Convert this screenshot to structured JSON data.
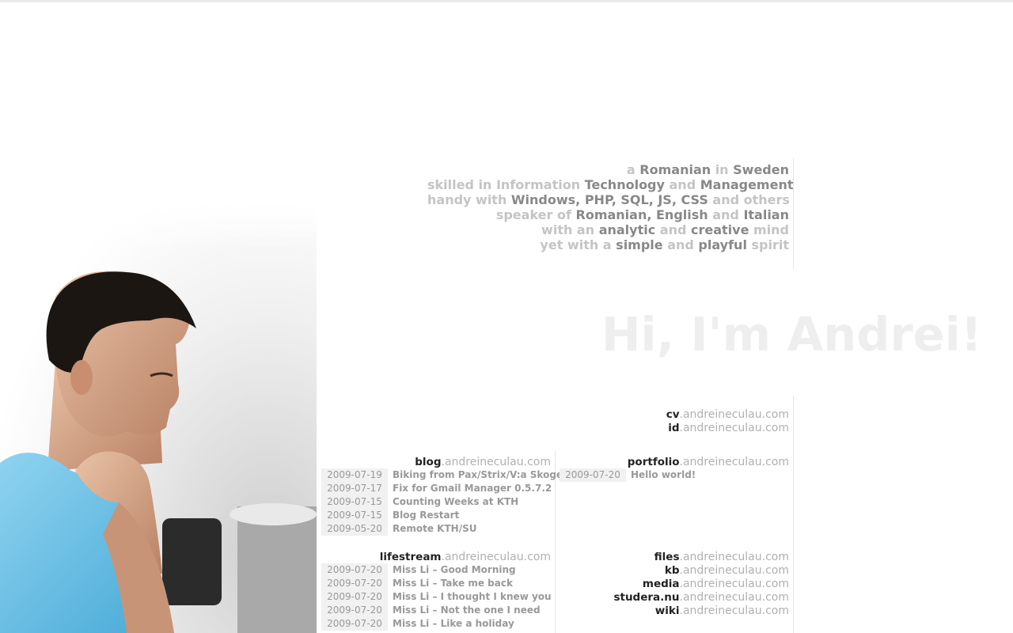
{
  "tagline": [
    [
      {
        "t": "a ",
        "h": false
      },
      {
        "t": "Romanian",
        "h": true
      },
      {
        "t": " in ",
        "h": false
      },
      {
        "t": "Sweden",
        "h": true
      }
    ],
    [
      {
        "t": "skilled in ",
        "h": false
      },
      {
        "t": "Information",
        "h": false
      },
      {
        "t": " Technology",
        "h": true
      },
      {
        "t": " and ",
        "h": false
      },
      {
        "t": "Management",
        "h": true
      }
    ],
    [
      {
        "t": "handy with ",
        "h": false
      },
      {
        "t": "Windows, PHP, SQL, JS, CSS",
        "h": true
      },
      {
        "t": " and others",
        "h": false
      }
    ],
    [
      {
        "t": "speaker of ",
        "h": false
      },
      {
        "t": "Romanian, English",
        "h": true
      },
      {
        "t": " and ",
        "h": false
      },
      {
        "t": "Italian",
        "h": true
      }
    ],
    [
      {
        "t": "with an ",
        "h": false
      },
      {
        "t": "analytic",
        "h": true
      },
      {
        "t": " and ",
        "h": false
      },
      {
        "t": "creative",
        "h": true
      },
      {
        "t": " mind",
        "h": false
      }
    ],
    [
      {
        "t": "yet with a ",
        "h": false
      },
      {
        "t": "simple",
        "h": true
      },
      {
        "t": " and ",
        "h": false
      },
      {
        "t": "playful",
        "h": true
      },
      {
        "t": " spirit",
        "h": false
      }
    ]
  ],
  "greeting": "Hi, I'm Andrei!",
  "domain": ".andreineculau.com",
  "links": {
    "cv": "cv",
    "id": "id",
    "blog": "blog",
    "portfolio": "portfolio",
    "lifestream": "lifestream",
    "files": "files",
    "kb": "kb",
    "media": "media",
    "studera": "studera.nu",
    "wiki": "wiki"
  },
  "blog_posts": [
    {
      "date": "2009-07-19",
      "title": "Biking from Pax/Strix/V:a Skoge"
    },
    {
      "date": "2009-07-17",
      "title": "Fix for Gmail Manager 0.5.7.2"
    },
    {
      "date": "2009-07-15",
      "title": "Counting Weeks at KTH"
    },
    {
      "date": "2009-07-15",
      "title": "Blog Restart"
    },
    {
      "date": "2009-05-20",
      "title": "Remote KTH/SU"
    }
  ],
  "portfolio_posts": [
    {
      "date": "2009-07-20",
      "title": "Hello world!"
    }
  ],
  "lifestream_posts": [
    {
      "date": "2009-07-20",
      "title": "Miss Li – Good Morning"
    },
    {
      "date": "2009-07-20",
      "title": "Miss Li – Take me back"
    },
    {
      "date": "2009-07-20",
      "title": "Miss Li – I thought I knew you"
    },
    {
      "date": "2009-07-20",
      "title": "Miss Li – Not the one I need"
    },
    {
      "date": "2009-07-20",
      "title": "Miss Li – Like a holiday"
    }
  ]
}
